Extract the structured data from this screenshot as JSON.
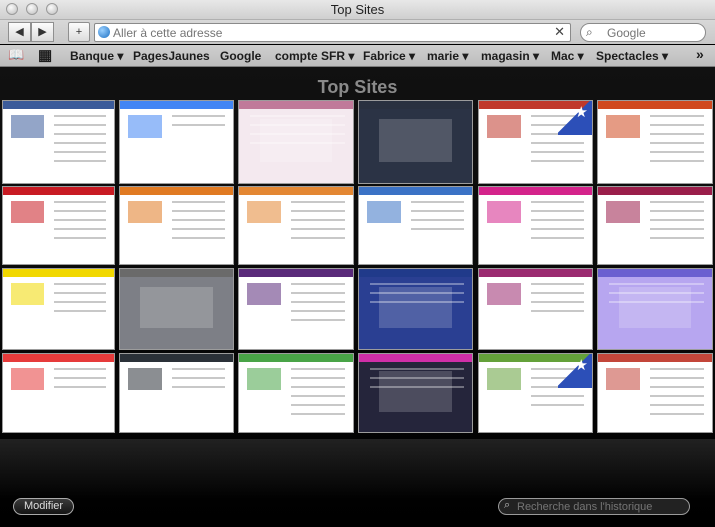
{
  "window": {
    "title": "Top Sites"
  },
  "toolbar": {
    "back_icon": "◀",
    "forward_icon": "▶",
    "add_icon": "+",
    "address_placeholder": "Aller à cette adresse",
    "clear_icon": "✕",
    "search_placeholder": "Google",
    "search_icon": "⌕"
  },
  "bookmarks": {
    "book_icon": "📖",
    "grid_icon": "▦",
    "items": [
      "Banque ▾",
      "PagesJaunes",
      "Google",
      "compte SFR ▾",
      "Fabrice ▾",
      "marie ▾",
      "magasin ▾",
      "Mac ▾",
      "Spectacles ▾"
    ],
    "overflow": "»"
  },
  "content": {
    "heading": "Top Sites",
    "modify_button": "Modifier",
    "history_search_placeholder": "Recherche dans l'historique",
    "history_search_icon": "⌕"
  },
  "tiles": [
    {
      "accent": "#3b5b9a",
      "body": "#ffffff",
      "rows": 6
    },
    {
      "accent": "#4285f4",
      "body": "#ffffff",
      "rows": 2
    },
    {
      "accent": "#c07a9a",
      "body": "#f4e9ef",
      "rows": 4
    },
    {
      "accent": "#2a3140",
      "body": "#2b3345",
      "rows": 0
    },
    {
      "accent": "#c0392b",
      "body": "#ffffff",
      "rows": 6,
      "star": true
    },
    {
      "accent": "#d0491f",
      "body": "#ffffff",
      "rows": 6
    },
    {
      "accent": "#c81b23",
      "body": "#ffffff",
      "rows": 5
    },
    {
      "accent": "#e07a22",
      "body": "#ffffff",
      "rows": 5
    },
    {
      "accent": "#e38733",
      "body": "#ffffff",
      "rows": 5
    },
    {
      "accent": "#3b72c5",
      "body": "#ffffff",
      "rows": 4
    },
    {
      "accent": "#d4238b",
      "body": "#ffffff",
      "rows": 5
    },
    {
      "accent": "#9a1e4a",
      "body": "#ffffff",
      "rows": 5
    },
    {
      "accent": "#f1d800",
      "body": "#ffffff",
      "rows": 4
    },
    {
      "accent": "#6a6a6a",
      "body": "#7d7f86",
      "rows": 0
    },
    {
      "accent": "#5a2a7a",
      "body": "#ffffff",
      "rows": 5
    },
    {
      "accent": "#203a8a",
      "body": "#2a3f92",
      "rows": 3
    },
    {
      "accent": "#9b2a70",
      "body": "#ffffff",
      "rows": 4
    },
    {
      "accent": "#6b5fd0",
      "body": "#b7a6f0",
      "rows": 3
    },
    {
      "accent": "#e63b3b",
      "body": "#ffffff",
      "rows": 3
    },
    {
      "accent": "#2b3138",
      "body": "#ffffff",
      "rows": 3
    },
    {
      "accent": "#49a447",
      "body": "#ffffff",
      "rows": 6
    },
    {
      "accent": "#d02fa8",
      "body": "#25253b",
      "rows": 3
    },
    {
      "accent": "#64a13a",
      "body": "#ffffff",
      "rows": 5,
      "star": true
    },
    {
      "accent": "#c3463a",
      "body": "#ffffff",
      "rows": 6
    }
  ]
}
